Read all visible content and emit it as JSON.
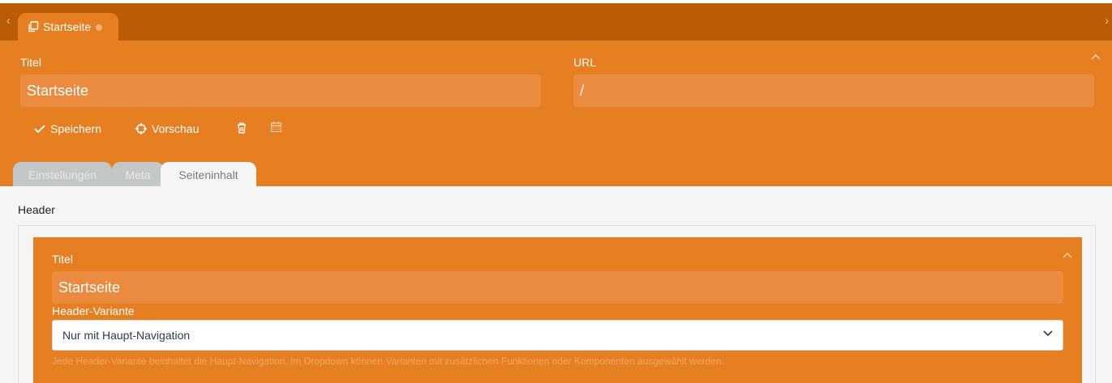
{
  "tabbar": {
    "doc_tab_label": "Startseite",
    "prev_icon": "chevron-left-icon",
    "next_icon": "chevron-right-icon"
  },
  "header": {
    "title_label": "Titel",
    "title_value": "Startseite",
    "url_label": "URL",
    "url_value": "/",
    "actions": {
      "save_label": "Speichern",
      "preview_label": "Vorschau",
      "delete_icon": "trash-icon",
      "schedule_icon": "calendar-icon"
    },
    "tabs": [
      {
        "label": "Einstellungen",
        "active": false
      },
      {
        "label": "Meta",
        "active": false
      },
      {
        "label": "Seiteninhalt",
        "active": true
      }
    ]
  },
  "content": {
    "section_title": "Header",
    "block": {
      "title_label": "Titel",
      "title_value": "Startseite",
      "variant_label": "Header-Variante",
      "variant_selected": "Nur mit Haupt-Navigation",
      "help_text": "Jede Header-Variante beinhaltet die Haupt-Navigation. Im Dropdown können Varianten mit zusätzlichen Funktionen oder Komponenten ausgewählt werden."
    }
  },
  "colors": {
    "brand_orange": "#e67e22",
    "dark_orange": "#bd5c06",
    "input_orange": "#ea8b3f",
    "content_bg": "#f5f5f5"
  }
}
